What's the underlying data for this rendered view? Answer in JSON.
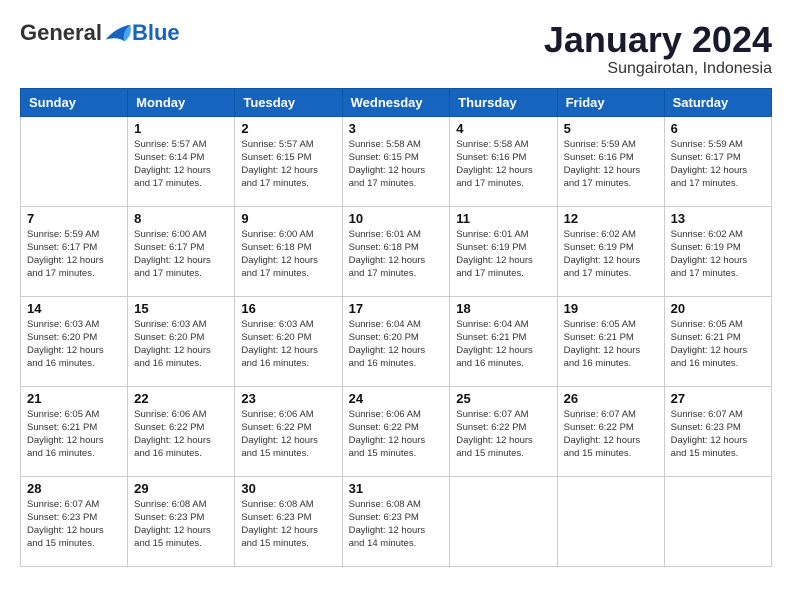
{
  "header": {
    "logo": {
      "general": "General",
      "blue": "Blue"
    },
    "title": "January 2024",
    "subtitle": "Sungairotan, Indonesia"
  },
  "days_of_week": [
    "Sunday",
    "Monday",
    "Tuesday",
    "Wednesday",
    "Thursday",
    "Friday",
    "Saturday"
  ],
  "weeks": [
    [
      {
        "day": "",
        "info": ""
      },
      {
        "day": "1",
        "info": "Sunrise: 5:57 AM\nSunset: 6:14 PM\nDaylight: 12 hours\nand 17 minutes."
      },
      {
        "day": "2",
        "info": "Sunrise: 5:57 AM\nSunset: 6:15 PM\nDaylight: 12 hours\nand 17 minutes."
      },
      {
        "day": "3",
        "info": "Sunrise: 5:58 AM\nSunset: 6:15 PM\nDaylight: 12 hours\nand 17 minutes."
      },
      {
        "day": "4",
        "info": "Sunrise: 5:58 AM\nSunset: 6:16 PM\nDaylight: 12 hours\nand 17 minutes."
      },
      {
        "day": "5",
        "info": "Sunrise: 5:59 AM\nSunset: 6:16 PM\nDaylight: 12 hours\nand 17 minutes."
      },
      {
        "day": "6",
        "info": "Sunrise: 5:59 AM\nSunset: 6:17 PM\nDaylight: 12 hours\nand 17 minutes."
      }
    ],
    [
      {
        "day": "7",
        "info": ""
      },
      {
        "day": "8",
        "info": "Sunrise: 6:00 AM\nSunset: 6:17 PM\nDaylight: 12 hours\nand 17 minutes."
      },
      {
        "day": "9",
        "info": "Sunrise: 6:00 AM\nSunset: 6:18 PM\nDaylight: 12 hours\nand 17 minutes."
      },
      {
        "day": "10",
        "info": "Sunrise: 6:01 AM\nSunset: 6:18 PM\nDaylight: 12 hours\nand 17 minutes."
      },
      {
        "day": "11",
        "info": "Sunrise: 6:01 AM\nSunset: 6:19 PM\nDaylight: 12 hours\nand 17 minutes."
      },
      {
        "day": "12",
        "info": "Sunrise: 6:02 AM\nSunset: 6:19 PM\nDaylight: 12 hours\nand 17 minutes."
      },
      {
        "day": "13",
        "info": "Sunrise: 6:02 AM\nSunset: 6:19 PM\nDaylight: 12 hours\nand 17 minutes."
      }
    ],
    [
      {
        "day": "14",
        "info": ""
      },
      {
        "day": "15",
        "info": "Sunrise: 6:03 AM\nSunset: 6:20 PM\nDaylight: 12 hours\nand 16 minutes."
      },
      {
        "day": "16",
        "info": "Sunrise: 6:03 AM\nSunset: 6:20 PM\nDaylight: 12 hours\nand 16 minutes."
      },
      {
        "day": "17",
        "info": "Sunrise: 6:04 AM\nSunset: 6:20 PM\nDaylight: 12 hours\nand 16 minutes."
      },
      {
        "day": "18",
        "info": "Sunrise: 6:04 AM\nSunset: 6:21 PM\nDaylight: 12 hours\nand 16 minutes."
      },
      {
        "day": "19",
        "info": "Sunrise: 6:05 AM\nSunset: 6:21 PM\nDaylight: 12 hours\nand 16 minutes."
      },
      {
        "day": "20",
        "info": "Sunrise: 6:05 AM\nSunset: 6:21 PM\nDaylight: 12 hours\nand 16 minutes."
      }
    ],
    [
      {
        "day": "21",
        "info": ""
      },
      {
        "day": "22",
        "info": "Sunrise: 6:06 AM\nSunset: 6:22 PM\nDaylight: 12 hours\nand 16 minutes."
      },
      {
        "day": "23",
        "info": "Sunrise: 6:06 AM\nSunset: 6:22 PM\nDaylight: 12 hours\nand 15 minutes."
      },
      {
        "day": "24",
        "info": "Sunrise: 6:06 AM\nSunset: 6:22 PM\nDaylight: 12 hours\nand 15 minutes."
      },
      {
        "day": "25",
        "info": "Sunrise: 6:07 AM\nSunset: 6:22 PM\nDaylight: 12 hours\nand 15 minutes."
      },
      {
        "day": "26",
        "info": "Sunrise: 6:07 AM\nSunset: 6:22 PM\nDaylight: 12 hours\nand 15 minutes."
      },
      {
        "day": "27",
        "info": "Sunrise: 6:07 AM\nSunset: 6:23 PM\nDaylight: 12 hours\nand 15 minutes."
      }
    ],
    [
      {
        "day": "28",
        "info": "Sunrise: 6:07 AM\nSunset: 6:23 PM\nDaylight: 12 hours\nand 15 minutes."
      },
      {
        "day": "29",
        "info": "Sunrise: 6:08 AM\nSunset: 6:23 PM\nDaylight: 12 hours\nand 15 minutes."
      },
      {
        "day": "30",
        "info": "Sunrise: 6:08 AM\nSunset: 6:23 PM\nDaylight: 12 hours\nand 15 minutes."
      },
      {
        "day": "31",
        "info": "Sunrise: 6:08 AM\nSunset: 6:23 PM\nDaylight: 12 hours\nand 14 minutes."
      },
      {
        "day": "",
        "info": ""
      },
      {
        "day": "",
        "info": ""
      },
      {
        "day": "",
        "info": ""
      }
    ]
  ],
  "week_sunday_info": [
    {
      "day": "7",
      "info": "Sunrise: 5:59 AM\nSunset: 6:17 PM\nDaylight: 12 hours\nand 17 minutes."
    },
    {
      "day": "14",
      "info": "Sunrise: 6:03 AM\nSunset: 6:20 PM\nDaylight: 12 hours\nand 16 minutes."
    },
    {
      "day": "21",
      "info": "Sunrise: 6:05 AM\nSunset: 6:21 PM\nDaylight: 12 hours\nand 16 minutes."
    }
  ]
}
